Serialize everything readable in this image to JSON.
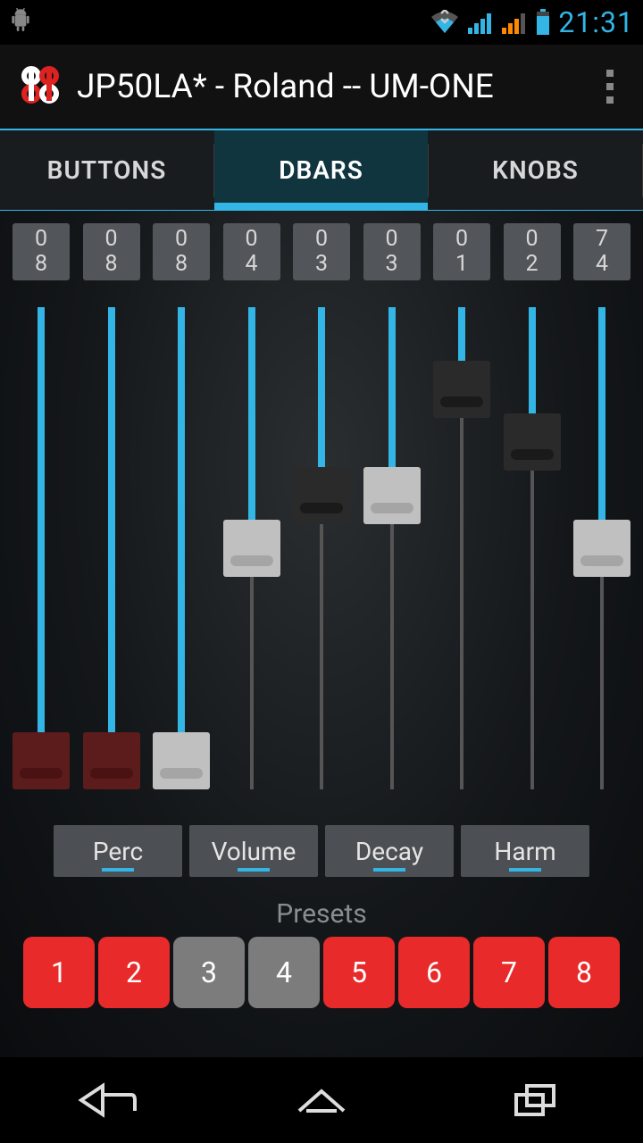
{
  "status": {
    "time": "21:31"
  },
  "header": {
    "title": "JP50LA* - Roland -- UM-ONE"
  },
  "tabs": {
    "items": [
      {
        "label": "BUTTONS"
      },
      {
        "label": "DBARS"
      },
      {
        "label": "KNOBS"
      }
    ],
    "active_index": 1
  },
  "drawbars": [
    {
      "display_top": "0",
      "display_bottom": "8",
      "value": 8,
      "max": 8,
      "thumb": "dark-red"
    },
    {
      "display_top": "0",
      "display_bottom": "8",
      "value": 8,
      "max": 8,
      "thumb": "dark-red"
    },
    {
      "display_top": "0",
      "display_bottom": "8",
      "value": 8,
      "max": 8,
      "thumb": "light"
    },
    {
      "display_top": "0",
      "display_bottom": "4",
      "value": 4,
      "max": 8,
      "thumb": "light"
    },
    {
      "display_top": "0",
      "display_bottom": "3",
      "value": 3,
      "max": 8,
      "thumb": "dark"
    },
    {
      "display_top": "0",
      "display_bottom": "3",
      "value": 3,
      "max": 8,
      "thumb": "light"
    },
    {
      "display_top": "0",
      "display_bottom": "1",
      "value": 1,
      "max": 8,
      "thumb": "dark"
    },
    {
      "display_top": "0",
      "display_bottom": "2",
      "value": 2,
      "max": 8,
      "thumb": "dark"
    },
    {
      "display_top": "7",
      "display_bottom": "4",
      "value": 4,
      "max": 8,
      "thumb": "light"
    }
  ],
  "actions": {
    "items": [
      {
        "label": "Perc"
      },
      {
        "label": "Volume"
      },
      {
        "label": "Decay"
      },
      {
        "label": "Harm"
      }
    ]
  },
  "presets": {
    "label": "Presets",
    "items": [
      {
        "label": "1",
        "color": "red"
      },
      {
        "label": "2",
        "color": "red"
      },
      {
        "label": "3",
        "color": "gray"
      },
      {
        "label": "4",
        "color": "gray"
      },
      {
        "label": "5",
        "color": "red"
      },
      {
        "label": "6",
        "color": "red"
      },
      {
        "label": "7",
        "color": "red"
      },
      {
        "label": "8",
        "color": "red"
      }
    ]
  }
}
